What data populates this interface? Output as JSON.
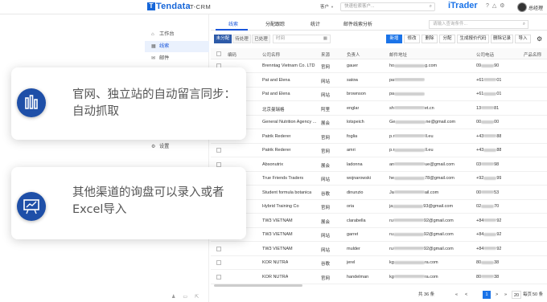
{
  "header": {
    "logo": "Tendata",
    "app_name": "T-CRM",
    "customer_select": "客户",
    "search_placeholder": "快速检索客户...",
    "itrader": "iTrader",
    "username": "总经理"
  },
  "sidebar": {
    "items": [
      {
        "label": "工作台",
        "icon": "home-icon",
        "glyph": "⌂"
      },
      {
        "label": "线索",
        "icon": "grid-icon",
        "glyph": "▦"
      },
      {
        "label": "邮件",
        "icon": "mail-icon",
        "glyph": "✉"
      },
      {
        "label": "设置",
        "icon": "gear-icon",
        "glyph": "⚙"
      }
    ],
    "bottom_icons": [
      "user-icon",
      "printer-icon",
      "share-icon"
    ]
  },
  "tabs": [
    {
      "label": "线索",
      "active": true
    },
    {
      "label": "分配跟踪",
      "active": false
    },
    {
      "label": "统计",
      "active": false
    },
    {
      "label": "邮件线索分析",
      "active": false
    }
  ],
  "tab_search_placeholder": "请输入查询条件...",
  "filters": {
    "status_buttons": [
      "未分配",
      "待处理",
      "已处理"
    ],
    "time_placeholder": "时间"
  },
  "actions": [
    "新增",
    "修改",
    "删除",
    "分配",
    "生成报价代码",
    "删除记录",
    "导入"
  ],
  "table": {
    "headers": [
      "编码",
      "公司名称",
      "来源",
      "负责人",
      "邮件地址",
      "公司电话",
      "产品名称"
    ],
    "rows": [
      {
        "company": "Brenntag Vietnam Co. LTD",
        "source": "官网",
        "owner": "gauer",
        "email_prefix": "ho",
        "email_suffix": "g.com",
        "phone_prefix": "09",
        "phone_suffix": "90"
      },
      {
        "company": "Pat and Elena",
        "source": "网站",
        "owner": "satow",
        "email_prefix": "pa",
        "email_suffix": "",
        "phone_prefix": "+61",
        "phone_suffix": "01"
      },
      {
        "company": "Pat and Elena",
        "source": "网站",
        "owner": "brownson",
        "email_prefix": "pa",
        "email_suffix": "",
        "phone_prefix": "+61",
        "phone_suffix": "01"
      },
      {
        "company": "北京曼瑞格",
        "source": "阿里",
        "owner": "englar",
        "email_prefix": "sh",
        "email_suffix": "et.cn",
        "phone_prefix": "13",
        "phone_suffix": "81"
      },
      {
        "company": "General Nutrition Agency ...",
        "source": "展会",
        "owner": "lotspeich",
        "email_prefix": "Ge",
        "email_suffix": "ne@gmail.com",
        "phone_prefix": "00",
        "phone_suffix": "00"
      },
      {
        "company": "Patrik Rederer",
        "source": "官网",
        "owner": "foglia",
        "email_prefix": "p.r",
        "email_suffix": "ll.eu",
        "phone_prefix": "+43",
        "phone_suffix": "88"
      },
      {
        "company": "Patrik Rederer",
        "source": "官网",
        "owner": "amri",
        "email_prefix": "p.r",
        "email_suffix": "ll.eu",
        "phone_prefix": "+43",
        "phone_suffix": "88"
      },
      {
        "company": "Absonutrix",
        "source": "展会",
        "owner": "ladonna",
        "email_prefix": "an",
        "email_suffix": "ue@gmail.com",
        "phone_prefix": "03",
        "phone_suffix": "98"
      },
      {
        "company": "True Friends Traders",
        "source": "网站",
        "owner": "wojnarowski",
        "email_prefix": "he",
        "email_suffix": "78@gmail.com",
        "phone_prefix": "+92",
        "phone_suffix": "99"
      },
      {
        "company": "Student formula botanica",
        "source": "谷歌",
        "owner": "dinunzio",
        "email_prefix": "Ja",
        "email_suffix": "ail.com",
        "phone_prefix": "00",
        "phone_suffix": "53"
      },
      {
        "company": "Hybrid Training Co",
        "source": "官网",
        "owner": "oria",
        "email_prefix": "ja",
        "email_suffix": "93@gmail.com",
        "phone_prefix": "02",
        "phone_suffix": "70"
      },
      {
        "company": "TW3 VIETNAM",
        "source": "展会",
        "owner": "clarabella",
        "email_prefix": "ru",
        "email_suffix": "92@gmail.com",
        "phone_prefix": "+84",
        "phone_suffix": "92"
      },
      {
        "company": "TW3 VIETNAM",
        "source": "网站",
        "owner": "garret",
        "email_prefix": "ru",
        "email_suffix": "92@gmail.com",
        "phone_prefix": "+84",
        "phone_suffix": "92"
      },
      {
        "company": "TW3 VIETNAM",
        "source": "网站",
        "owner": "mulder",
        "email_prefix": "ru",
        "email_suffix": "92@gmail.com",
        "phone_prefix": "+84",
        "phone_suffix": "92"
      },
      {
        "company": "KOR NUTRA",
        "source": "谷歌",
        "owner": "jerel",
        "email_prefix": "kg",
        "email_suffix": "ra.com",
        "phone_prefix": "80",
        "phone_suffix": "38"
      },
      {
        "company": "KOR NUTRA",
        "source": "官网",
        "owner": "handelman",
        "email_prefix": "kg",
        "email_suffix": "ra.com",
        "phone_prefix": "80",
        "phone_suffix": "38"
      }
    ]
  },
  "pagination": {
    "total": "共 36 条",
    "first": "«",
    "prev": "<",
    "current": "1",
    "next": ">",
    "last": "»",
    "page_size": "20",
    "per_page": "每页",
    "goto": "50 条"
  },
  "overlay": {
    "card1_text_line1": "官网、独立站的自动留言同步：",
    "card1_text_line2": "自动抓取",
    "card1_icon": "bar-chart-icon",
    "card2_text_line1": "其他渠道的询盘可以录入或者",
    "card2_text_line2": "Excel导入",
    "card2_icon": "presentation-icon"
  },
  "colors": {
    "brand_blue": "#1a73e8",
    "dark_blue": "#2d5aa8",
    "icon_circle": "#1e4fa8"
  }
}
